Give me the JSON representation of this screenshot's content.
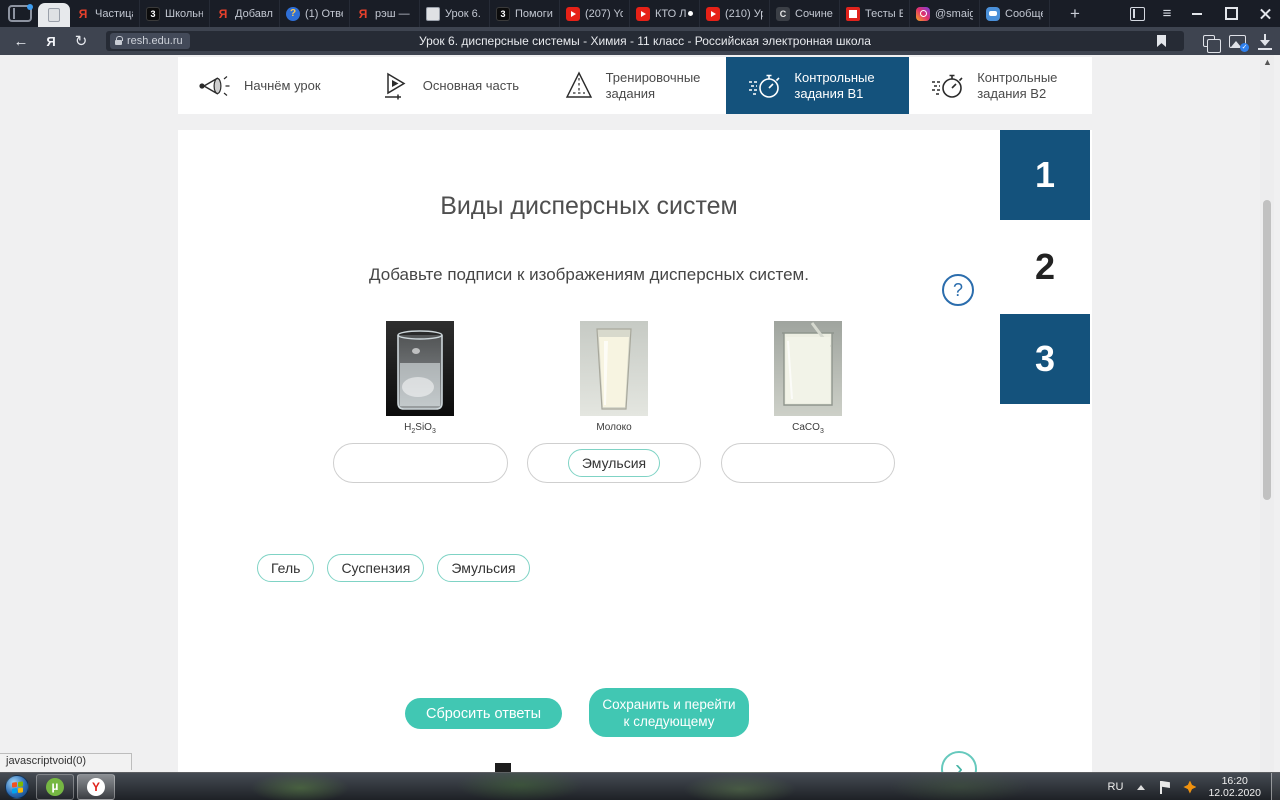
{
  "browser": {
    "tabs": [
      {
        "title": "Частица",
        "glyph": "Я"
      },
      {
        "title": "Школьн",
        "glyph": "3"
      },
      {
        "title": "Добавл",
        "glyph": "Я"
      },
      {
        "title": "(1) Отве",
        "glyph": "?"
      },
      {
        "title": "рэш — Я",
        "glyph": "Я"
      },
      {
        "title": "Урок 6.",
        "glyph": ""
      },
      {
        "title": "Помоги",
        "glyph": "3"
      },
      {
        "title": "(207) Yo",
        "glyph": ""
      },
      {
        "title": "КТО Л",
        "glyph": ""
      },
      {
        "title": "(210) Ур",
        "glyph": ""
      },
      {
        "title": "Сочине",
        "glyph": "С"
      },
      {
        "title": "Тесты Е",
        "glyph": ""
      },
      {
        "title": "@smaig",
        "glyph": ""
      },
      {
        "title": "Сообще",
        "glyph": ""
      }
    ],
    "address": {
      "url": "resh.edu.ru",
      "page_title": "Урок 6. дисперсные системы - Химия - 11 класс - Российская электронная школа"
    }
  },
  "icons": {
    "back_glyph": "←",
    "reload_glyph": "↻",
    "yandex_button_glyph": "Я",
    "new_tab_glyph": "+",
    "menu_glyph": "≡",
    "help_glyph": "?",
    "next_glyph": "›",
    "scroll_top_glyph": "▲",
    "check_glyph": "✓",
    "utorrent_glyph": "µ",
    "yandex_app_glyph": "Y"
  },
  "lesson_nav": {
    "items": [
      {
        "label": "Начнём урок"
      },
      {
        "label": "Основная часть"
      },
      {
        "label": "Тренировочные задания"
      },
      {
        "label": "Контрольные задания В1"
      },
      {
        "label": "Контрольные задания В2"
      }
    ],
    "active_index": 3
  },
  "question_numbers": [
    {
      "label": "1",
      "highlighted": true
    },
    {
      "label": "2",
      "highlighted": false
    },
    {
      "label": "3",
      "highlighted": true
    }
  ],
  "content": {
    "title": "Виды дисперсных систем",
    "instruction": "Добавьте подписи к изображениям дисперсных систем.",
    "figures": [
      {
        "caption_parts": [
          {
            "text": "H"
          },
          {
            "text": "2"
          },
          {
            "text": "SiO"
          },
          {
            "text": "3"
          }
        ]
      },
      {
        "caption_parts": [
          {
            "text": "Молоко"
          }
        ]
      },
      {
        "caption_parts": [
          {
            "text": "CaCO"
          },
          {
            "text": "3"
          }
        ]
      }
    ],
    "drop_zones": [
      {
        "value": ""
      },
      {
        "value": "Эмульсия"
      },
      {
        "value": ""
      }
    ],
    "answer_chips": [
      "Гель",
      "Суспензия",
      "Эмульсия"
    ],
    "buttons": {
      "reset": "Сбросить ответы",
      "save": "Сохранить и перейти к следующему"
    }
  },
  "status_bar": {
    "text": "javascriptvoid(0)"
  },
  "taskbar": {
    "language": "RU",
    "time": "16:20",
    "date": "12.02.2020"
  },
  "colors": {
    "accent_blue": "#14527C",
    "teal": "#41C7B3",
    "chip_border": "#7FD3C5",
    "help_blue": "#2B6DAD",
    "tabstrip_bg": "#191D26",
    "toolbar_bg": "#3E4450",
    "page_bg": "#F0F0F1"
  }
}
